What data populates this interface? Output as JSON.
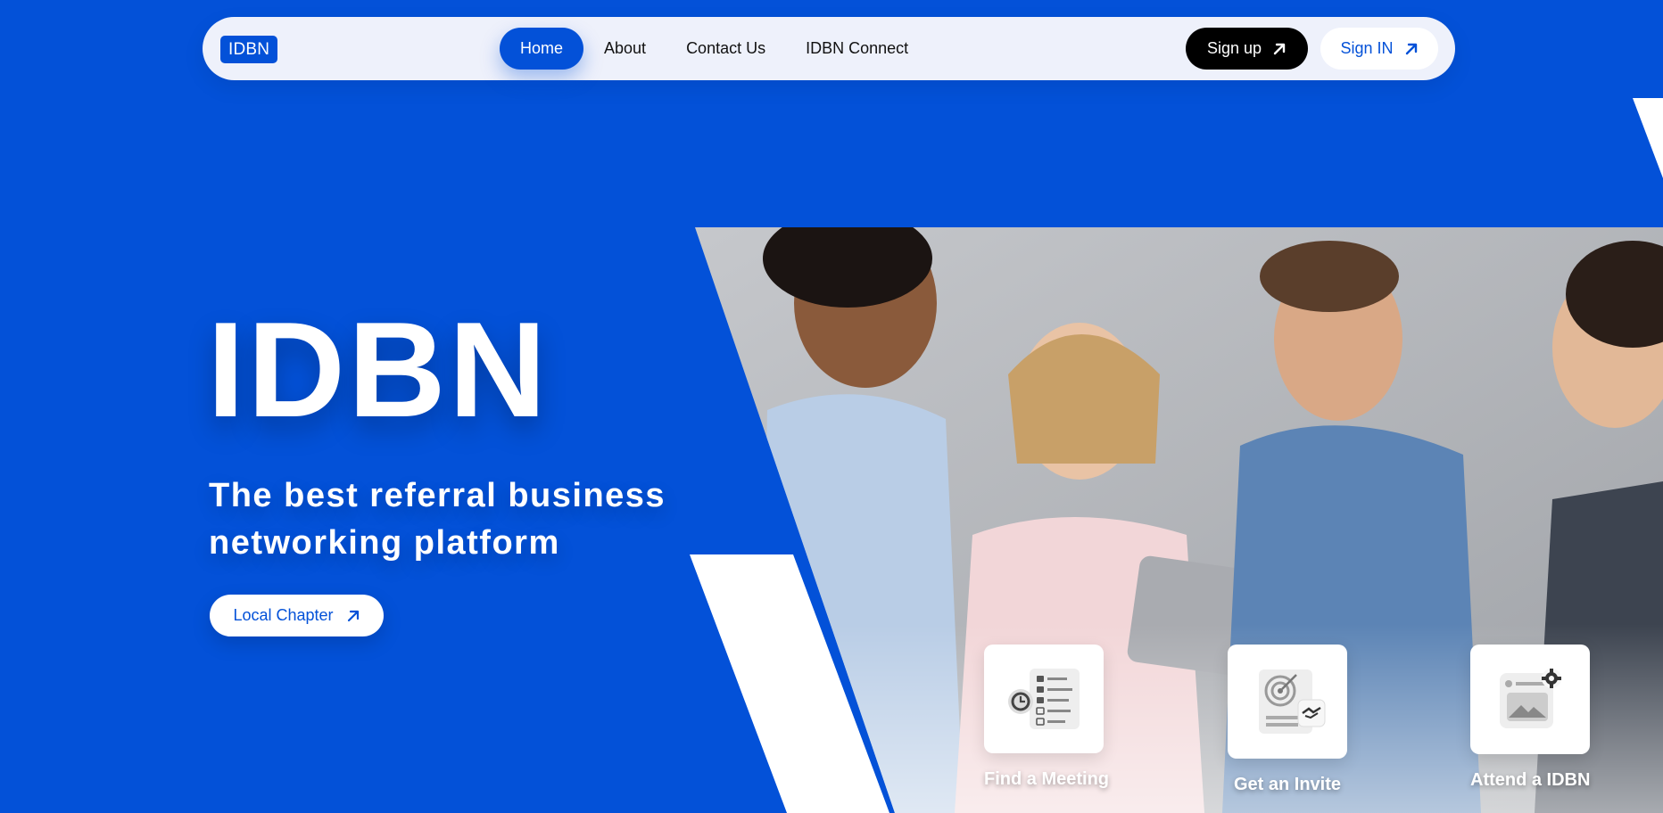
{
  "brand": {
    "logo": "IDBN",
    "accent": "#0351d8"
  },
  "nav": {
    "links": [
      "Home",
      "About",
      "Contact Us",
      "IDBN Connect"
    ],
    "signup": "Sign up",
    "signin": "Sign IN"
  },
  "hero": {
    "title": "IDBN",
    "subtitle": "The best referral business networking platform",
    "cta": "Local Chapter"
  },
  "features": [
    {
      "label": "Find a Meeting",
      "icon": "checklist-clock-icon"
    },
    {
      "label": "Get an Invite",
      "icon": "target-handshake-icon"
    },
    {
      "label": "Attend a IDBN",
      "icon": "image-gear-icon"
    }
  ]
}
